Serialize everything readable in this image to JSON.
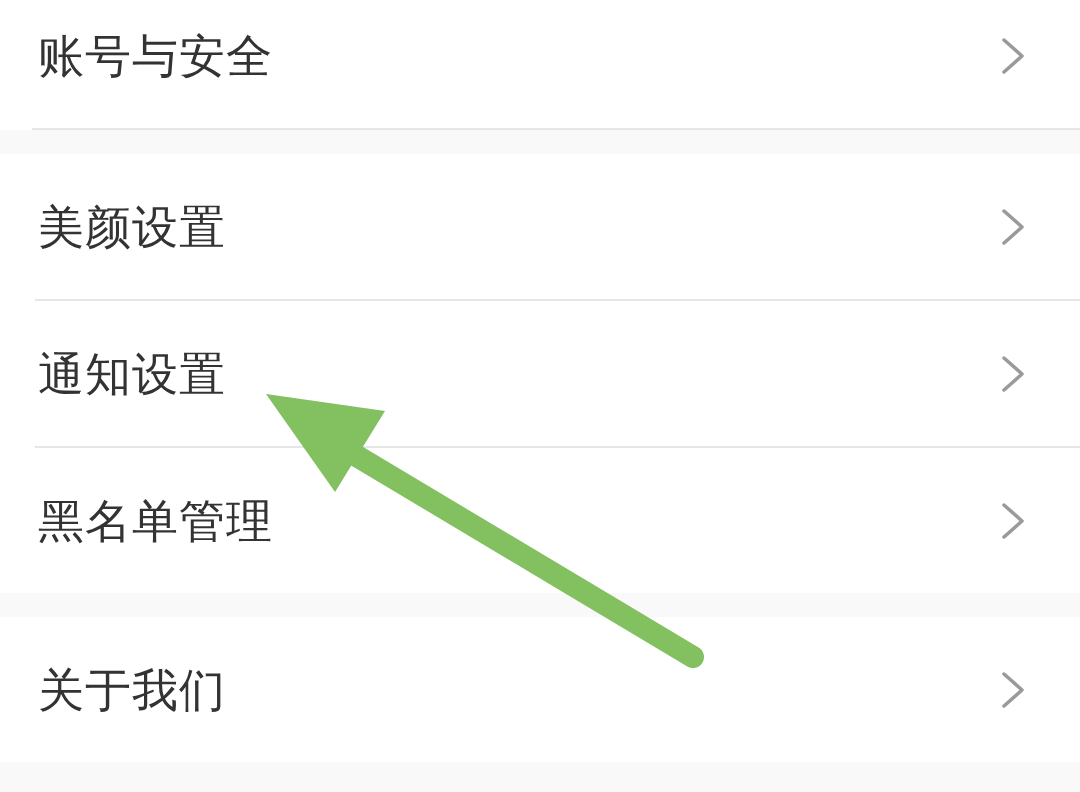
{
  "groups": [
    {
      "items": [
        {
          "label": "账号与安全"
        }
      ]
    },
    {
      "items": [
        {
          "label": "美颜设置"
        },
        {
          "label": "通知设置"
        },
        {
          "label": "黑名单管理"
        }
      ]
    },
    {
      "items": [
        {
          "label": "关于我们"
        }
      ]
    }
  ]
}
